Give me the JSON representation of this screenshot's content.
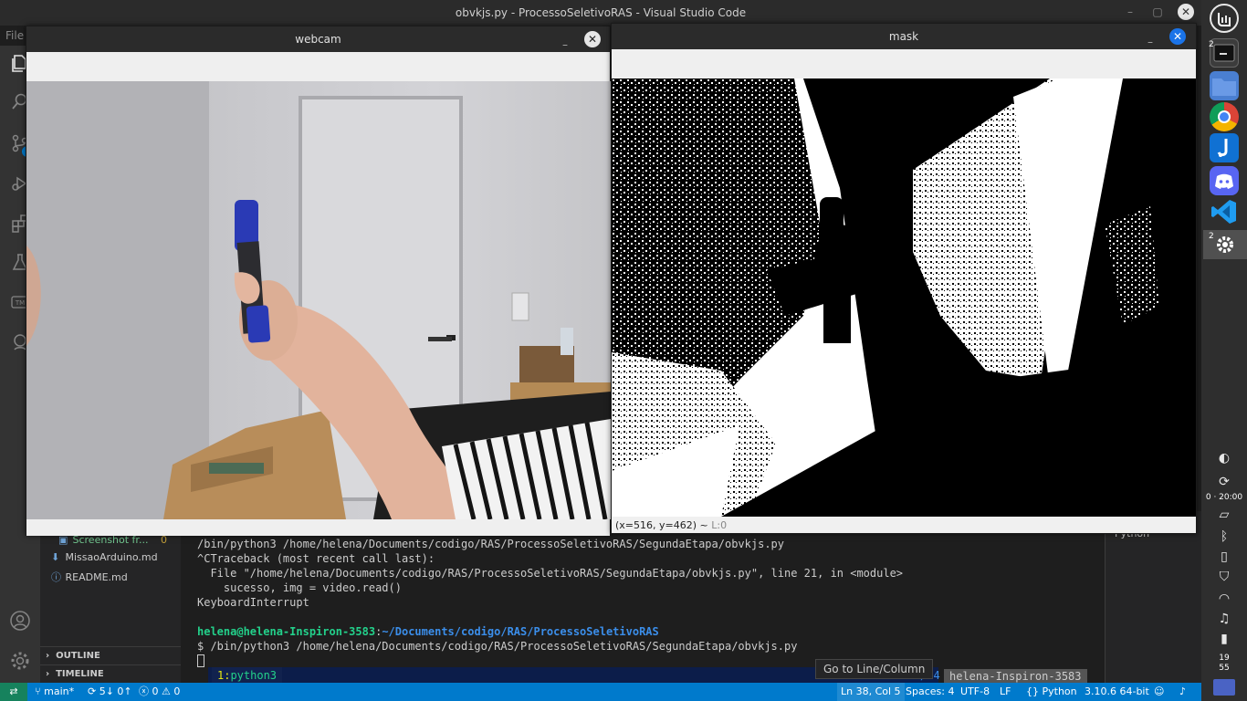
{
  "vscode": {
    "title": "obvkjs.py - ProcessoSeletivoRAS - Visual Studio Code",
    "menu_fragment": "File",
    "win_min": "–",
    "win_max": "▢",
    "win_close": "✕",
    "activity_icons": [
      "files-icon",
      "search-icon",
      "source-control-icon",
      "run-debug-icon",
      "extensions-icon",
      "testing-icon",
      "tm-icon",
      "remote-icon"
    ],
    "source_control_badge": "2"
  },
  "sidebar": {
    "items": [
      {
        "label": "Screenshot fr...",
        "badge": "0",
        "icon": "image-icon"
      },
      {
        "label": "MissaoArduino.md",
        "icon": "markdown-download-icon"
      },
      {
        "label": "README.md",
        "icon": "info-icon"
      }
    ],
    "outline_label": "OUTLINE",
    "timeline_label": "TIMELINE"
  },
  "terminal": {
    "lines": [
      "/bin/python3 /home/helena/Documents/codigo/RAS/ProcessoSeletivoRAS/SegundaEtapa/obvkjs.py",
      "^CTraceback (most recent call last):",
      "  File \"/home/helena/Documents/codigo/RAS/ProcessoSeletivoRAS/SegundaEtapa/obvkjs.py\", line 21, in <module>",
      "    sucesso, img = video.read()",
      "KeyboardInterrupt"
    ],
    "prompt_user": "helena@helena-Inspiron-3583",
    "prompt_sep": ":",
    "prompt_path": "~/Documents/codigo/RAS/ProcessoSeletivoRAS",
    "command_line": "$ /bin/python3 /home/helena/Documents/codigo/RAS/ProcessoSeletivoRAS/SegundaEtapa/obvkjs.py",
    "tab_number": "1:",
    "tab_name": "python3",
    "right_fragment": "/04",
    "hostname": "helena-Inspiron-3583"
  },
  "right_pane_label": "Python",
  "tooltip": "Go to Line/Column",
  "statusbar": {
    "remote_icon": "remote-icon",
    "branch": "main*",
    "sync": "5↓ 0↑",
    "problems": "0 ⚠ 0",
    "ln_col": "Ln 38, Col 5",
    "spaces": "Spaces: 4",
    "encoding": "UTF-8",
    "eol": "LF",
    "language": "Python",
    "interpreter": "3.10.6 64-bit"
  },
  "webcam_window": {
    "title": "webcam",
    "min": "–",
    "close": "✕"
  },
  "mask_window": {
    "title": "mask",
    "min": "–",
    "close": "✕",
    "status": "(x=516, y=462) ~",
    "status_extra": "L:0"
  },
  "dock": {
    "apps": [
      "mint-menu-icon",
      "terminal-icon",
      "files-icon",
      "chrome-icon",
      "joplin-icon",
      "discord-icon",
      "vscode-icon",
      "settings-icon"
    ],
    "badge_terminal": "2",
    "badge_settings": "2",
    "tray_icons": [
      "night-light-icon",
      "update-icon",
      "notes-icon",
      "bluetooth-icon",
      "clipboard-icon",
      "shield-icon",
      "wifi-icon",
      "music-icon",
      "battery-icon"
    ],
    "clock_a": "0 · 20:00",
    "clock_hour": "19",
    "clock_minute": "55"
  },
  "colors": {
    "statusbar": "#007acc",
    "remote": "#16825d",
    "terminal_green": "#23d18b",
    "terminal_blue": "#3b8eea"
  }
}
